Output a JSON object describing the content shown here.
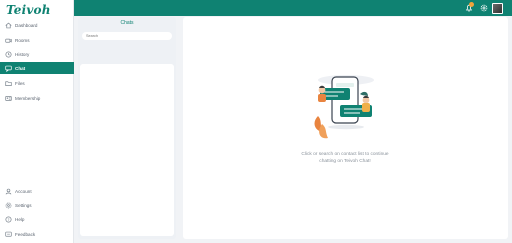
{
  "logo": "Teivoh",
  "sidebar": {
    "items": [
      {
        "label": "Dashboard",
        "icon": "home-icon"
      },
      {
        "label": "Rooms",
        "icon": "video-icon"
      },
      {
        "label": "History",
        "icon": "history-icon"
      },
      {
        "label": "Chat",
        "icon": "chat-icon",
        "active": true
      },
      {
        "label": "Files",
        "icon": "folder-icon"
      },
      {
        "label": "Membership",
        "icon": "membership-icon"
      }
    ],
    "bottom": [
      {
        "label": "Account",
        "icon": "user-icon"
      },
      {
        "label": "Settings",
        "icon": "gear-icon"
      },
      {
        "label": "Help",
        "icon": "help-icon"
      },
      {
        "label": "Feedback",
        "icon": "feedback-icon"
      }
    ]
  },
  "chats": {
    "title": "Chats",
    "search_placeholder": "Search"
  },
  "empty_state": {
    "line1": "Click or search on contact list to continue",
    "line2": "chatting on Teivoh Chat!"
  },
  "colors": {
    "brand": "#0f8272",
    "accent": "#f2a33a"
  }
}
